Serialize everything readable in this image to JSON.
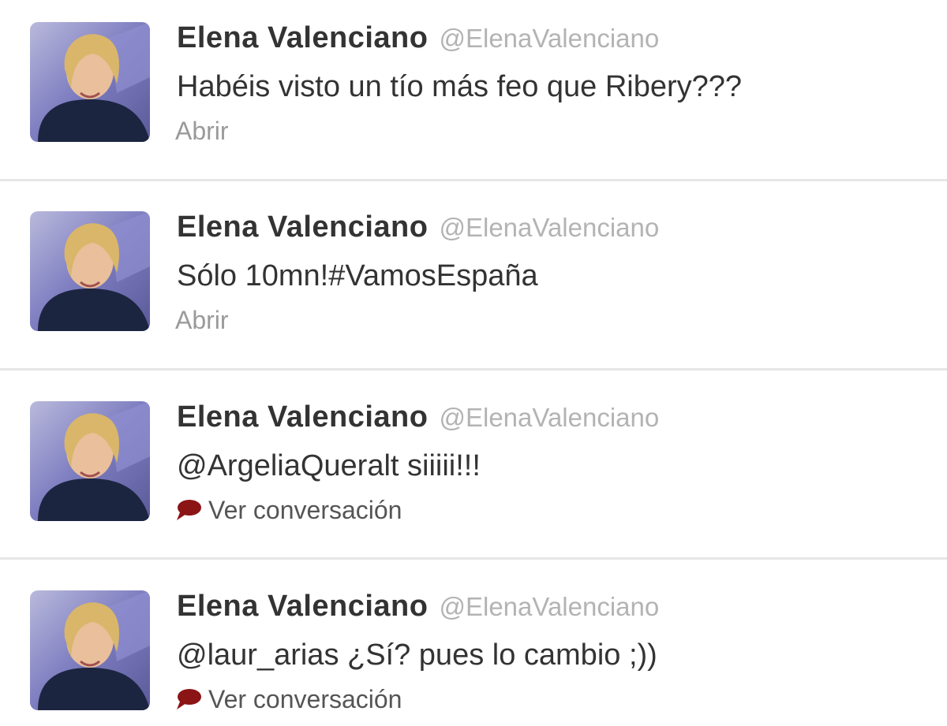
{
  "tweets": [
    {
      "name": "Elena Valenciano",
      "handle": "@ElenaValenciano",
      "text": "Habéis visto un tío más feo que Ribery???",
      "action": "Abrir",
      "action_type": "open"
    },
    {
      "name": "Elena Valenciano",
      "handle": "@ElenaValenciano",
      "text": "Sólo 10mn!#VamosEspaña",
      "action": "Abrir",
      "action_type": "open"
    },
    {
      "name": "Elena Valenciano",
      "handle": "@ElenaValenciano",
      "text": "@ArgeliaQueralt siiiii!!!",
      "action": "Ver conversación",
      "action_type": "conversation"
    },
    {
      "name": "Elena Valenciano",
      "handle": "@ElenaValenciano",
      "text": "@laur_arias ¿Sí? pues lo cambio ;))",
      "action": "Ver conversación",
      "action_type": "conversation"
    }
  ],
  "icons": {
    "conversation": "speech-bubble-icon"
  },
  "colors": {
    "name": "#333333",
    "handle": "#b3b3b3",
    "open_link": "#9a9a9a",
    "conversation_icon": "#8b1414",
    "avatar_background": "#6a6aa8"
  }
}
